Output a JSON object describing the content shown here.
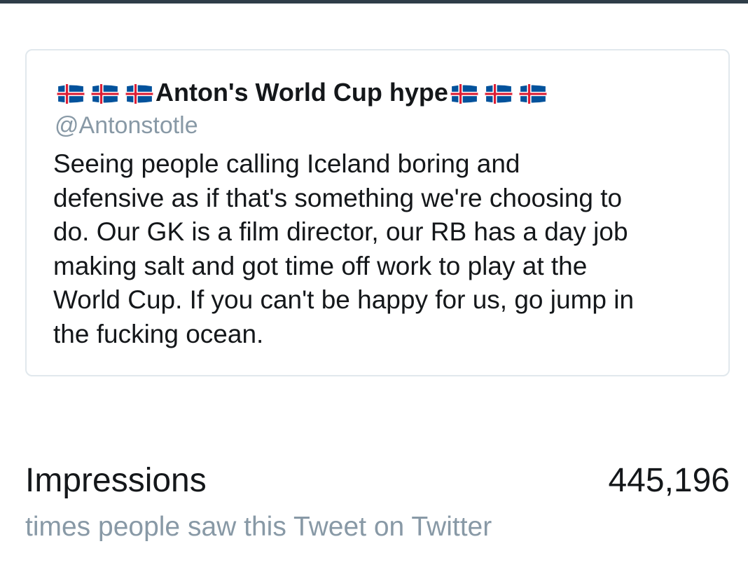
{
  "tweet": {
    "display_name": "Anton's World Cup hype",
    "flag_icon": "iceland-flag-icon",
    "flags_before": 3,
    "flags_after": 3,
    "handle": "@Antonstotle",
    "text_lines": [
      "Seeing people calling Iceland boring and",
      "defensive as if that's something we're choosing to",
      "do. Our GK is a film director, our RB has a day job",
      "making salt and got time off work to play at the",
      "World Cup. If you can't be happy for us, go jump in",
      "the fucking ocean."
    ]
  },
  "stats": {
    "label": "Impressions",
    "value": "445,196",
    "description": "times people saw this Tweet on Twitter"
  },
  "colors": {
    "top_bar": "#2f3d48",
    "primary_text": "#14171a",
    "secondary_text": "#8899a6",
    "card_border": "#e1e8ed",
    "flag_blue": "#02529c",
    "flag_red": "#dc1e35",
    "flag_white": "#ffffff"
  }
}
